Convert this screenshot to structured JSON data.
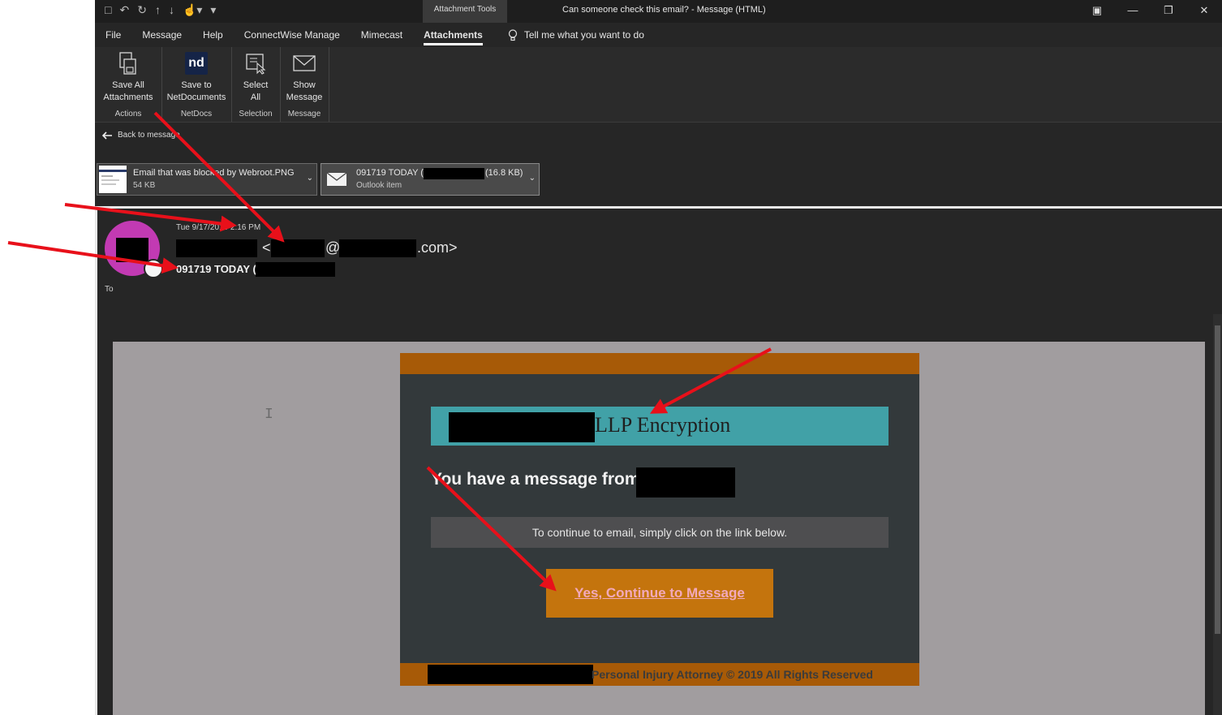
{
  "window": {
    "qat_icons": [
      "save-icon",
      "undo-icon",
      "redo-icon",
      "up-icon",
      "down-icon",
      "touch-icon",
      "more-icon"
    ],
    "context_tab": "Attachment Tools",
    "title": "Can someone check this email?  -  Message (HTML)"
  },
  "ribbon_tabs": [
    {
      "label": "File"
    },
    {
      "label": "Message"
    },
    {
      "label": "Help"
    },
    {
      "label": "ConnectWise Manage"
    },
    {
      "label": "Mimecast"
    },
    {
      "label": "Attachments",
      "active": true
    }
  ],
  "tell_me": "Tell me what you want to do",
  "ribbon": {
    "actions": {
      "group_label": "Actions",
      "button_line1": "Save All",
      "button_line2": "Attachments"
    },
    "netdocs": {
      "group_label": "NetDocs",
      "logo": "nd",
      "button_line1": "Save to",
      "button_line2": "NetDocuments"
    },
    "selection": {
      "group_label": "Selection",
      "button_line1": "Select",
      "button_line2": "All"
    },
    "message": {
      "group_label": "Message",
      "button_line1": "Show",
      "button_line2": "Message"
    }
  },
  "back_link": "Back to message",
  "attachments": [
    {
      "name": "Email that was blocked by Webroot.PNG",
      "size": "54 KB"
    },
    {
      "name_prefix": "091719 TODAY (",
      "name_suffix": "(16.8 KB)",
      "subtitle": "Outlook item"
    }
  ],
  "header": {
    "date": "Tue 9/17/2019 2:16 PM",
    "from_open": "<",
    "from_at": "@",
    "from_close": ".com>",
    "subject": "091719 TODAY (",
    "to_label": "To"
  },
  "email": {
    "banner_text": "LLP Encryption",
    "message_from": "You have a message from",
    "instruction": "To continue to email, simply click on the link below.",
    "cta": "Yes, Continue to Message",
    "footer": "Personal Injury Attorney © 2019 All Rights Reserved"
  },
  "colors": {
    "accent_orange": "#a75a07",
    "button_orange": "#c4740d",
    "banner_teal": "#41a1a7",
    "avatar_magenta": "#c23ab3",
    "annotation_red": "#e8101a"
  }
}
